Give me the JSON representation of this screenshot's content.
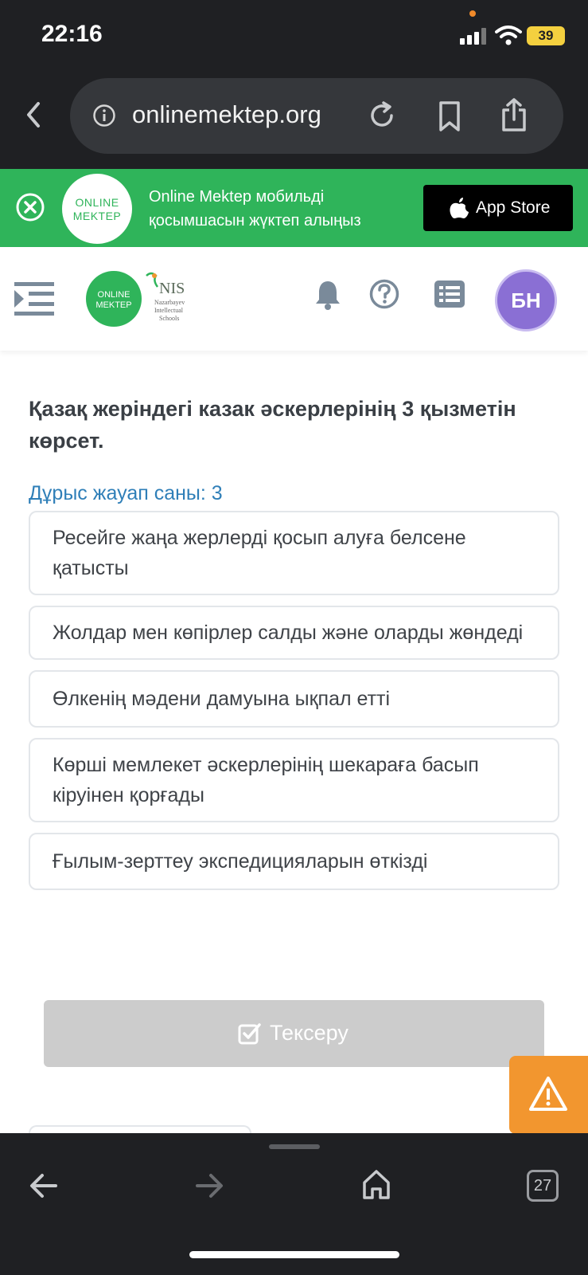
{
  "status_bar": {
    "time": "22:16",
    "battery": "39"
  },
  "browser": {
    "url": "onlinemektep.org",
    "tab_count": "27"
  },
  "banner": {
    "logo_line1": "ONLINE",
    "logo_line2": "MEKTEP",
    "text_line1": "Online Mektep мобильді",
    "text_line2": "қосымшасын жүктеп алыңыз",
    "appstore_label": "App Store"
  },
  "header": {
    "logo_line1": "ONLINE",
    "logo_line2": "MEKTEP",
    "nis_title": "NIS",
    "nis_line1": "Nazarbayev",
    "nis_line2": "Intellectual",
    "nis_line3": "Schools",
    "avatar_initials": "БН"
  },
  "quiz": {
    "question": "Қазақ жеріндегі казак әскерлерінің 3 қызметін көрсет.",
    "answer_count_label": "Дұрыс жауап саны: 3",
    "options": [
      {
        "text": "Ресейге жаңа жерлерді қосып алуға белсене қатысты"
      },
      {
        "text": "Жолдар мен көпірлер салды және оларды жөндеді"
      },
      {
        "text": "Өлкенің мәдени дамуына ықпал етті"
      },
      {
        "text": "Көрші мемлекет әскерлерінің шекараға басып кіруінен қорғады"
      },
      {
        "text": "Ғылым-зерттеу экспедицияларын өткізді"
      }
    ],
    "check_label": "Тексеру"
  },
  "colors": {
    "accent_green": "#2fb45a",
    "link_blue": "#2f7fb8",
    "warning_orange": "#f2962f",
    "avatar_purple": "#8a6fd4"
  }
}
